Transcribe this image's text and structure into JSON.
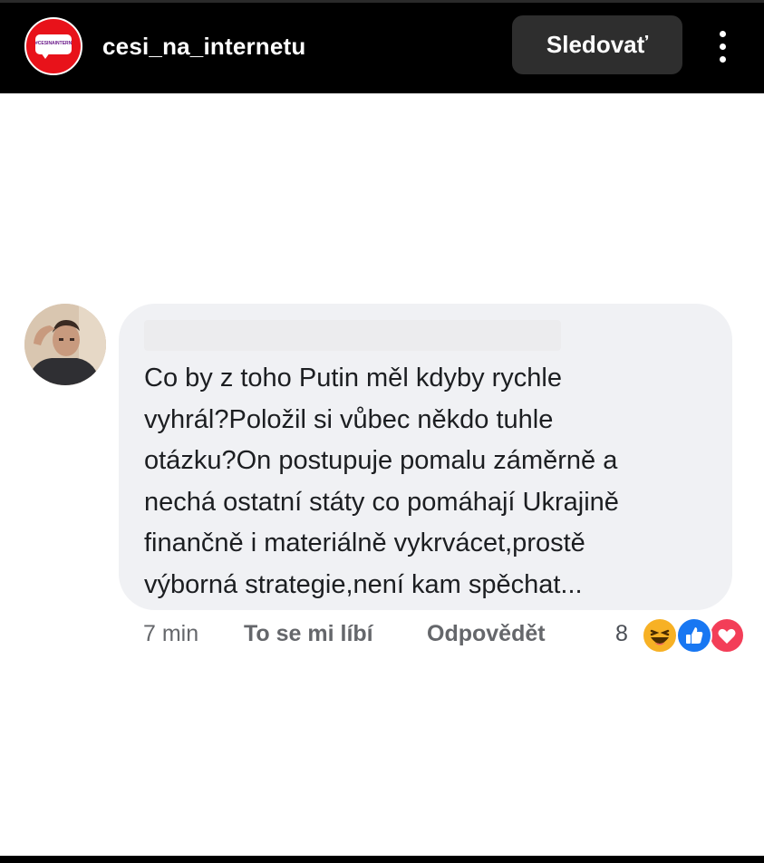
{
  "header": {
    "username": "cesi_na_internetu",
    "follow_label": "Sledovať",
    "logo_text": "#ČEŠINAINTERNETU"
  },
  "comment": {
    "lines": [
      "Co by z toho Putin měl kdyby rychle",
      "vyhrál?Položil si vůbec někdo tuhle",
      "otázku?On postupuje pomalu záměrně a",
      "nechá ostatní státy co pomáhají Ukrajině",
      "finančně i materiálně vykrvácet,prostě",
      "výborná strategie,není kam spěchat..."
    ],
    "time": "7 min",
    "like_label": "To se mi líbí",
    "reply_label": "Odpovědět",
    "reaction_count": "8",
    "reactions": [
      "haha-icon",
      "like-icon",
      "love-icon"
    ]
  },
  "colors": {
    "logo_red": "#e8121a",
    "like_blue": "#1877f2",
    "love_red": "#f33e58",
    "haha_yellow": "#f7b125"
  }
}
